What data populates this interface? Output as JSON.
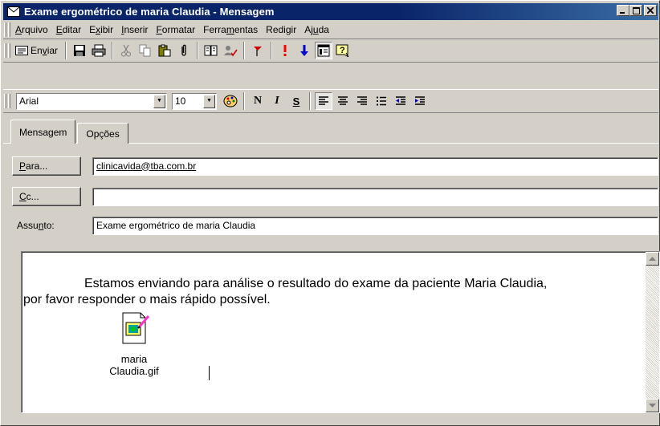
{
  "window": {
    "title": "Exame ergométrico de maria Claudia - Mensagem",
    "min_label": "_",
    "max_label": "□",
    "close_label": "✕"
  },
  "menu": [
    {
      "label": "Arquivo",
      "accel": "A"
    },
    {
      "label": "Editar",
      "accel": "E"
    },
    {
      "label": "Exibir",
      "accel": "x"
    },
    {
      "label": "Inserir",
      "accel": "I"
    },
    {
      "label": "Formatar",
      "accel": "F"
    },
    {
      "label": "Ferramentas",
      "accel": "m"
    },
    {
      "label": "Redigir",
      "accel": "g"
    },
    {
      "label": "Ajuda",
      "accel": "u"
    }
  ],
  "toolbar": {
    "send_label": "Enviar"
  },
  "format": {
    "font_value": "Arial",
    "size_value": "10",
    "bold_label": "N",
    "italic_label": "I",
    "underline_label": "S"
  },
  "tabs": [
    {
      "label": "Mensagem",
      "active": true
    },
    {
      "label": "Opções",
      "active": false
    }
  ],
  "fields": {
    "to_button": "Para...",
    "to_value": "clinicavida@tba.com.br",
    "cc_button": "Cc...",
    "cc_value": "",
    "subject_label": "Assunto:",
    "subject_value": "Exame ergométrico de maria Claudia"
  },
  "message": {
    "line1": "Estamos enviando para análise o resultado do exame da paciente Maria Claudia,",
    "line2": "por favor responder o mais rápido possível.",
    "attachment_name": "maria Claudia.gif"
  },
  "colors": {
    "title_bg": "#0a246a",
    "face": "#d4d0c8",
    "priority_high": "#ff0000",
    "priority_low": "#0000cc"
  }
}
